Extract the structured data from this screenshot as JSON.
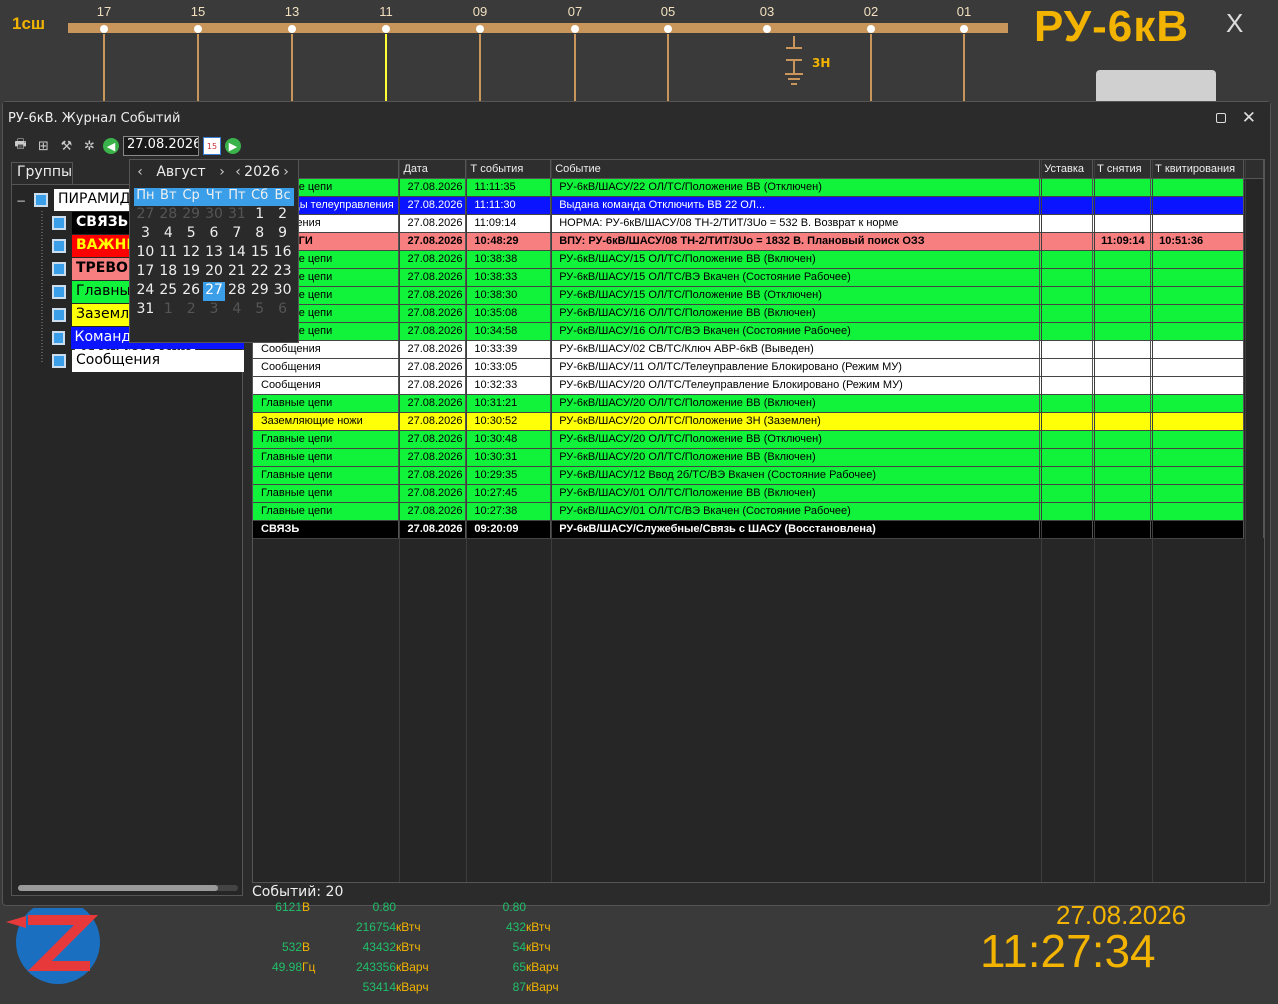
{
  "busbar": {
    "label": "1сш",
    "feeders": [
      "17",
      "15",
      "13",
      "11",
      "09",
      "07",
      "05",
      "03",
      "02",
      "01"
    ]
  },
  "header": {
    "title": "РУ-6кВ",
    "close": "X"
  },
  "zn_label": "3Н",
  "window": {
    "title": "РУ-6кВ. Журнал Событий"
  },
  "toolbar": {
    "date_value": "27.08.2026",
    "cal_icon_text": "15"
  },
  "groups_tab": "Группы",
  "tree": [
    {
      "label": "ПИРАМИДА",
      "bg": "#ffffff",
      "fg": "#000000",
      "bold": false
    },
    {
      "label": "СВЯЗЬ",
      "bg": "#000000",
      "fg": "#ffffff",
      "bold": true
    },
    {
      "label": "ВАЖНЫЕ",
      "bg": "#ff0000",
      "fg": "#ffff00",
      "bold": true
    },
    {
      "label": "ТРЕВОГИ",
      "bg": "#f87f7f",
      "fg": "#000000",
      "bold": true
    },
    {
      "label": "Главные цепи",
      "bg": "#11f33a",
      "fg": "#000000",
      "bold": false
    },
    {
      "label": "Заземляющие ножи",
      "bg": "#ffff08",
      "fg": "#000000",
      "bold": false
    },
    {
      "label": "Команды телеуправления",
      "bg": "#0a14ff",
      "fg": "#ffffff",
      "bold": false
    },
    {
      "label": "Сообщения",
      "bg": "#ffffff",
      "fg": "#000000",
      "bold": false
    }
  ],
  "calendar": {
    "month": "Август",
    "year": "2026",
    "weekdays": [
      "Пн",
      "Вт",
      "Ср",
      "Чт",
      "Пт",
      "Сб",
      "Вс"
    ],
    "weeks": [
      [
        "27",
        "28",
        "29",
        "30",
        "31",
        "1",
        "2"
      ],
      [
        "3",
        "4",
        "5",
        "6",
        "7",
        "8",
        "9"
      ],
      [
        "10",
        "11",
        "12",
        "13",
        "14",
        "15",
        "16"
      ],
      [
        "17",
        "18",
        "19",
        "20",
        "21",
        "22",
        "23"
      ],
      [
        "24",
        "25",
        "26",
        "27",
        "28",
        "29",
        "30"
      ],
      [
        "31",
        "1",
        "2",
        "3",
        "4",
        "5",
        "6"
      ]
    ],
    "selected": "27"
  },
  "table": {
    "columns": [
      "",
      "Дата",
      "Т события",
      "Событие",
      "Уставка",
      "Т снятия",
      "Т квитирования"
    ],
    "rows": [
      {
        "style": "green",
        "group": "Главные цепи",
        "date": "27.08.2026",
        "time": "11:11:35",
        "event": "РУ-6кВ/ШАСУ/22 ОЛ/ТС/Положение ВВ (Отключен)",
        "setpoint": "",
        "t_off": "",
        "t_ack": ""
      },
      {
        "style": "blue",
        "group": "Команды телеуправления",
        "date": "27.08.2026",
        "time": "11:11:30",
        "event": "Выдана команда Отключить ВВ 22 ОЛ...",
        "setpoint": "",
        "t_off": "",
        "t_ack": ""
      },
      {
        "style": "white",
        "group": "Сообщения",
        "date": "27.08.2026",
        "time": "11:09:14",
        "event": "НОРМА: РУ-6кВ/ШАСУ/08 ТН-2/ТИТ/3Uo = 532 В. Возврат к норме",
        "setpoint": "",
        "t_off": "",
        "t_ack": ""
      },
      {
        "style": "red",
        "group": "ТРЕВОГИ",
        "date": "27.08.2026",
        "time": "10:48:29",
        "event": "ВПУ: РУ-6кВ/ШАСУ/08 ТН-2/ТИТ/3Uo = 1832 В. Плановый поиск ОЗЗ",
        "setpoint": "",
        "t_off": "11:09:14",
        "t_ack": "10:51:36"
      },
      {
        "style": "green",
        "group": "Главные цепи",
        "date": "27.08.2026",
        "time": "10:38:38",
        "event": "РУ-6кВ/ШАСУ/15 ОЛ/ТС/Положение ВВ (Включен)",
        "setpoint": "",
        "t_off": "",
        "t_ack": ""
      },
      {
        "style": "green",
        "group": "Главные цепи",
        "date": "27.08.2026",
        "time": "10:38:33",
        "event": "РУ-6кВ/ШАСУ/15 ОЛ/ТС/ВЭ Вкачен (Состояние Рабочее)",
        "setpoint": "",
        "t_off": "",
        "t_ack": ""
      },
      {
        "style": "green",
        "group": "Главные цепи",
        "date": "27.08.2026",
        "time": "10:38:30",
        "event": "РУ-6кВ/ШАСУ/15 ОЛ/ТС/Положение ВВ (Отключен)",
        "setpoint": "",
        "t_off": "",
        "t_ack": ""
      },
      {
        "style": "green",
        "group": "Главные цепи",
        "date": "27.08.2026",
        "time": "10:35:08",
        "event": "РУ-6кВ/ШАСУ/16 ОЛ/ТС/Положение ВВ (Включен)",
        "setpoint": "",
        "t_off": "",
        "t_ack": ""
      },
      {
        "style": "green",
        "group": "Главные цепи",
        "date": "27.08.2026",
        "time": "10:34:58",
        "event": "РУ-6кВ/ШАСУ/16 ОЛ/ТС/ВЭ Вкачен (Состояние Рабочее)",
        "setpoint": "",
        "t_off": "",
        "t_ack": ""
      },
      {
        "style": "white",
        "group": "Сообщения",
        "date": "27.08.2026",
        "time": "10:33:39",
        "event": "РУ-6кВ/ШАСУ/02 СВ/ТС/Ключ АВР-6кВ (Выведен)",
        "setpoint": "",
        "t_off": "",
        "t_ack": ""
      },
      {
        "style": "white",
        "group": "Сообщения",
        "date": "27.08.2026",
        "time": "10:33:05",
        "event": "РУ-6кВ/ШАСУ/11 ОЛ/ТС/Телеуправление Блокировано (Режим МУ)",
        "setpoint": "",
        "t_off": "",
        "t_ack": ""
      },
      {
        "style": "white",
        "group": "Сообщения",
        "date": "27.08.2026",
        "time": "10:32:33",
        "event": "РУ-6кВ/ШАСУ/20 ОЛ/ТС/Телеуправление Блокировано (Режим МУ)",
        "setpoint": "",
        "t_off": "",
        "t_ack": ""
      },
      {
        "style": "green",
        "group": "Главные цепи",
        "date": "27.08.2026",
        "time": "10:31:21",
        "event": "РУ-6кВ/ШАСУ/20 ОЛ/ТС/Положение ВВ (Включен)",
        "setpoint": "",
        "t_off": "",
        "t_ack": ""
      },
      {
        "style": "yellow",
        "group": "Заземляющие ножи",
        "date": "27.08.2026",
        "time": "10:30:52",
        "event": "РУ-6кВ/ШАСУ/20 ОЛ/ТС/Положение ЗН (Заземлен)",
        "setpoint": "",
        "t_off": "",
        "t_ack": ""
      },
      {
        "style": "green",
        "group": "Главные цепи",
        "date": "27.08.2026",
        "time": "10:30:48",
        "event": "РУ-6кВ/ШАСУ/20 ОЛ/ТС/Положение ВВ (Отключен)",
        "setpoint": "",
        "t_off": "",
        "t_ack": ""
      },
      {
        "style": "green",
        "group": "Главные цепи",
        "date": "27.08.2026",
        "time": "10:30:31",
        "event": "РУ-6кВ/ШАСУ/20 ОЛ/ТС/Положение ВВ (Включен)",
        "setpoint": "",
        "t_off": "",
        "t_ack": ""
      },
      {
        "style": "green",
        "group": "Главные цепи",
        "date": "27.08.2026",
        "time": "10:29:35",
        "event": "РУ-6кВ/ШАСУ/12 Ввод 2б/ТС/ВЭ Вкачен (Состояние Рабочее)",
        "setpoint": "",
        "t_off": "",
        "t_ack": ""
      },
      {
        "style": "green",
        "group": "Главные цепи",
        "date": "27.08.2026",
        "time": "10:27:45",
        "event": "РУ-6кВ/ШАСУ/01 ОЛ/ТС/Положение ВВ (Включен)",
        "setpoint": "",
        "t_off": "",
        "t_ack": ""
      },
      {
        "style": "green",
        "group": "Главные цепи",
        "date": "27.08.2026",
        "time": "10:27:38",
        "event": "РУ-6кВ/ШАСУ/01 ОЛ/ТС/ВЭ Вкачен (Состояние Рабочее)",
        "setpoint": "",
        "t_off": "",
        "t_ack": ""
      },
      {
        "style": "black",
        "group": "СВЯЗЬ",
        "date": "27.08.2026",
        "time": "09:20:09",
        "event": "РУ-6кВ/ШАСУ/Служебные/Связь с ШАСУ (Восстановлена)",
        "setpoint": "",
        "t_off": "",
        "t_ack": ""
      }
    ]
  },
  "status": {
    "events_count": "Событий: 20"
  },
  "measurements": {
    "col1": [
      {
        "value": "6121",
        "unit": "В"
      },
      {
        "value": "",
        "unit": ""
      },
      {
        "value": "532",
        "unit": "В"
      },
      {
        "value": "49.98",
        "unit": "Гц"
      }
    ],
    "col2": [
      {
        "value": "0.80",
        "unit": ""
      },
      {
        "value": "216754",
        "unit": "кВтч"
      },
      {
        "value": "43432",
        "unit": "кВтч"
      },
      {
        "value": "243356",
        "unit": "кВарч"
      },
      {
        "value": "53414",
        "unit": "кВарч"
      }
    ],
    "col3": [
      {
        "value": "0.80",
        "unit": ""
      },
      {
        "value": "432",
        "unit": "кВтч"
      },
      {
        "value": "54",
        "unit": "кВтч"
      },
      {
        "value": "65",
        "unit": "кВарч"
      },
      {
        "value": "87",
        "unit": "кВарч"
      }
    ]
  },
  "clock": {
    "date": "27.08.2026",
    "time": "11:27:34"
  },
  "colors": {
    "accent": "#f2b400",
    "value_green": "#1fc06a",
    "busbar": "#c8965a",
    "selected_feeder": "#ffff33"
  }
}
